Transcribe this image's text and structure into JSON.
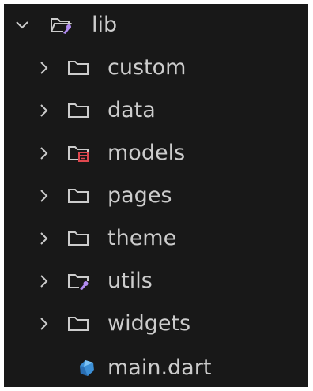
{
  "explorer": {
    "root": {
      "label": "lib",
      "expanded": true,
      "icon": "folder-lib-open-icon",
      "accent": "#b18cf1"
    },
    "items": [
      {
        "label": "custom",
        "type": "folder",
        "icon": "folder-icon"
      },
      {
        "label": "data",
        "type": "folder",
        "icon": "folder-icon"
      },
      {
        "label": "models",
        "type": "folder",
        "icon": "folder-models-icon",
        "accent": "#e0484f"
      },
      {
        "label": "pages",
        "type": "folder",
        "icon": "folder-icon"
      },
      {
        "label": "theme",
        "type": "folder",
        "icon": "folder-icon"
      },
      {
        "label": "utils",
        "type": "folder",
        "icon": "folder-utils-icon",
        "accent": "#b18cf1"
      },
      {
        "label": "widgets",
        "type": "folder",
        "icon": "folder-icon"
      },
      {
        "label": "main.dart",
        "type": "file",
        "icon": "dart-file-icon",
        "accent": "#3c8fd6"
      }
    ]
  },
  "colors": {
    "background": "#181818",
    "text": "#cccccc",
    "icon": "#cccccc"
  }
}
